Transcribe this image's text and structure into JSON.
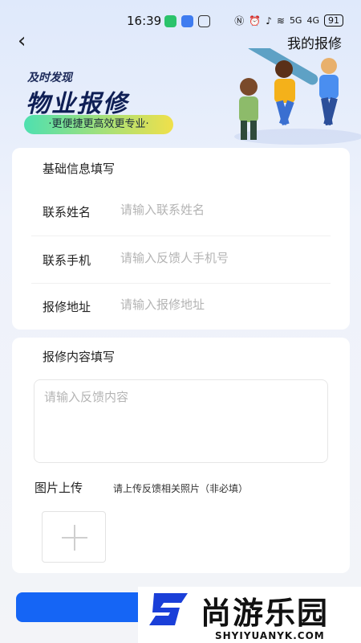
{
  "status_bar": {
    "time": "16:39",
    "battery": "91",
    "signal_1": "5G",
    "signal_2": "4G"
  },
  "nav": {
    "back_glyph": "‹",
    "title": "我的报修"
  },
  "banner": {
    "subtitle": "及时发现",
    "title": "物业报修",
    "tagline": "·更便捷更高效更专业·"
  },
  "basic_info": {
    "section_title": "基础信息填写",
    "rows": [
      {
        "label": "联系姓名",
        "placeholder": "请输入联系姓名"
      },
      {
        "label": "联系手机",
        "placeholder": "请输入反馈人手机号"
      },
      {
        "label": "报修地址",
        "placeholder": "请输入报修地址"
      }
    ]
  },
  "repair_content": {
    "section_title": "报修内容填写",
    "textarea_placeholder": "请输入反馈内容",
    "upload_label": "图片上传",
    "upload_hint": "请上传反馈相关照片（非必填）"
  },
  "colors": {
    "primary": "#1565f5",
    "banner_title": "#0f1f55",
    "placeholder": "#b4b4b4"
  },
  "watermark": {
    "brand": "尚游乐园",
    "url": "SHYIYUANYK.COM"
  }
}
